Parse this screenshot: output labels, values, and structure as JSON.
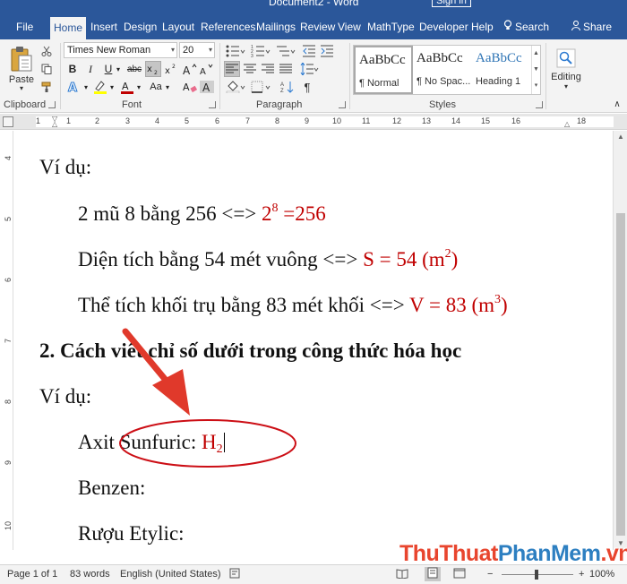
{
  "window": {
    "title": "Document2 - Word",
    "sign_in": "Sign in"
  },
  "tabs": [
    {
      "label": "File"
    },
    {
      "label": "Home"
    },
    {
      "label": "Insert"
    },
    {
      "label": "Design"
    },
    {
      "label": "Layout"
    },
    {
      "label": "References"
    },
    {
      "label": "Mailings"
    },
    {
      "label": "Review"
    },
    {
      "label": "View"
    },
    {
      "label": "MathType"
    },
    {
      "label": "Developer"
    },
    {
      "label": "Help"
    },
    {
      "label": "Search"
    },
    {
      "label": "Share"
    }
  ],
  "active_tab": "Home",
  "ribbon": {
    "clipboard": {
      "paste_label": "Paste",
      "group_label": "Clipboard"
    },
    "font": {
      "font_name": "Times New Roman",
      "font_size": "20",
      "group_label": "Font",
      "buttons": [
        "A",
        "A",
        "Aa",
        "B",
        "I",
        "U",
        "abc",
        "x2",
        "x2",
        "A",
        "A",
        "A"
      ],
      "pressed": "subscript"
    },
    "paragraph": {
      "group_label": "Paragraph"
    },
    "styles": {
      "group_label": "Styles",
      "items": [
        {
          "sample": "AaBbCc",
          "name": "¶ Normal"
        },
        {
          "sample": "AaBbCc",
          "name": "¶ No Spac..."
        },
        {
          "sample": "AaBbCc",
          "name": "Heading 1"
        }
      ]
    },
    "editing": {
      "label": "Editing"
    }
  },
  "ruler": {
    "labels": [
      "1",
      "1",
      "2",
      "3",
      "4",
      "5",
      "6",
      "7",
      "8",
      "9",
      "10",
      "11",
      "12",
      "13",
      "14",
      "15",
      "16",
      "18"
    ]
  },
  "vruler": {
    "labels": [
      "4",
      "5",
      "6",
      "7",
      "8",
      "9",
      "10"
    ]
  },
  "document": {
    "lines": [
      {
        "text": "Ví dụ:"
      },
      {
        "prefix": "2 mũ 8 bằng 256 <=> ",
        "red_base": "2",
        "red_sup": "8",
        "red_tail": " =256"
      },
      {
        "prefix": "Diện tích bằng 54 mét vuông <=> ",
        "red_base": "S = 54 (m",
        "red_sup": "2",
        "red_tail": ")"
      },
      {
        "prefix": "Thể tích khối trụ bằng 83 mét khối <=> ",
        "red_base": "V = 83 (m",
        "red_sup": "3",
        "red_tail": ")"
      },
      {
        "text": "2. Cách viết chỉ số dưới trong công thức hóa học"
      },
      {
        "text": "Ví dụ:"
      },
      {
        "prefix": "Axit Sunfuric: ",
        "red_base": "H",
        "red_sub": "2"
      },
      {
        "text": "Benzen:"
      },
      {
        "text": "Rượu Etylic:"
      }
    ]
  },
  "statusbar": {
    "page": "Page 1 of 1",
    "words": "83 words",
    "language": "English (United States)",
    "zoom": "100%"
  },
  "watermark": {
    "part1": "ThuThuat",
    "part2": "PhanMem",
    "part3": ".vn"
  },
  "colors": {
    "word_blue": "#2b579a",
    "highlight_red": "#c00000",
    "annotation_red": "#e0392b"
  }
}
